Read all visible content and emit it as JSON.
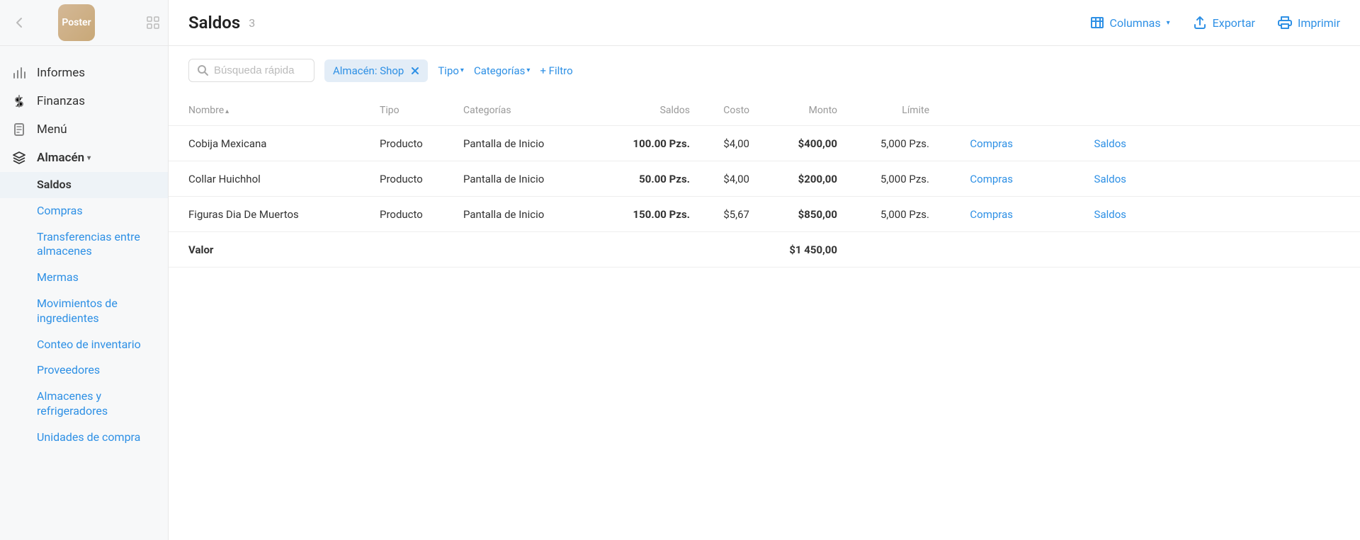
{
  "sidebar": {
    "logo_text": "Poster",
    "nav": [
      {
        "label": "Informes"
      },
      {
        "label": "Finanzas"
      },
      {
        "label": "Menú"
      },
      {
        "label": "Almacén"
      }
    ],
    "subnav": [
      {
        "label": "Saldos"
      },
      {
        "label": "Compras"
      },
      {
        "label": "Transferencias entre almacenes"
      },
      {
        "label": "Mermas"
      },
      {
        "label": "Movimientos de ingredientes"
      },
      {
        "label": "Conteo de inventario"
      },
      {
        "label": "Proveedores"
      },
      {
        "label": "Almacenes y refrigeradores"
      },
      {
        "label": "Unidades de compra"
      }
    ]
  },
  "header": {
    "title": "Saldos",
    "count": "3",
    "columnas": "Columnas",
    "exportar": "Exportar",
    "imprimir": "Imprimir"
  },
  "filters": {
    "search_placeholder": "Búsqueda rápida",
    "chip": "Almacén: Shop",
    "tipo": "Tipo",
    "categorias": "Categorías",
    "add_filtro": "+ Filtro"
  },
  "table": {
    "headers": {
      "nombre": "Nombre",
      "tipo": "Tipo",
      "categorias": "Categorías",
      "saldos": "Saldos",
      "costo": "Costo",
      "monto": "Monto",
      "limite": "Límite"
    },
    "rows": [
      {
        "nombre": "Cobija Mexicana",
        "tipo": "Producto",
        "categoria": "Pantalla de Inicio",
        "saldos": "100.00 Pzs.",
        "costo": "$4,00",
        "monto": "$400,00",
        "limite": "5,000 Pzs.",
        "link1": "Compras",
        "link2": "Saldos"
      },
      {
        "nombre": "Collar Huichhol",
        "tipo": "Producto",
        "categoria": "Pantalla de Inicio",
        "saldos": "50.00 Pzs.",
        "costo": "$4,00",
        "monto": "$200,00",
        "limite": "5,000 Pzs.",
        "link1": "Compras",
        "link2": "Saldos"
      },
      {
        "nombre": "Figuras Dia De Muertos",
        "tipo": "Producto",
        "categoria": "Pantalla de Inicio",
        "saldos": "150.00 Pzs.",
        "costo": "$5,67",
        "monto": "$850,00",
        "limite": "5,000 Pzs.",
        "link1": "Compras",
        "link2": "Saldos"
      }
    ],
    "footer": {
      "label": "Valor",
      "total": "$1 450,00"
    }
  }
}
